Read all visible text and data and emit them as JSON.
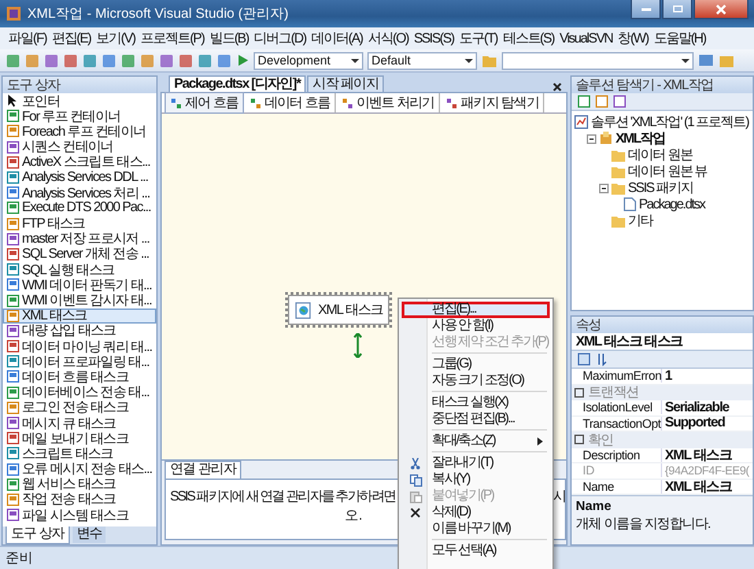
{
  "window": {
    "title": "XML작업 - Microsoft Visual Studio (관리자)"
  },
  "menu": [
    "파일(F)",
    "편집(E)",
    "보기(V)",
    "프로젝트(P)",
    "빌드(B)",
    "디버그(D)",
    "데이터(A)",
    "서식(O)",
    "SSIS(S)",
    "도구(T)",
    "테스트(S)",
    "VisualSVN",
    "창(W)",
    "도움말(H)"
  ],
  "toolbar": {
    "configuration": "Development",
    "platform": "Default"
  },
  "toolbox": {
    "title": "도구 상자",
    "items": [
      {
        "label": "포인터",
        "kind": "pointer",
        "selected": false
      },
      {
        "label": "For 루프 컨테이너",
        "kind": "task",
        "selected": false
      },
      {
        "label": "Foreach 루프 컨테이너",
        "kind": "task",
        "selected": false
      },
      {
        "label": "시퀀스 컨테이너",
        "kind": "task",
        "selected": false
      },
      {
        "label": "ActiveX 스크립트 태스...",
        "kind": "task",
        "selected": false
      },
      {
        "label": "Analysis Services DDL ...",
        "kind": "task",
        "selected": false
      },
      {
        "label": "Analysis Services 처리 ...",
        "kind": "task",
        "selected": false
      },
      {
        "label": "Execute DTS 2000 Pac...",
        "kind": "task",
        "selected": false
      },
      {
        "label": "FTP 태스크",
        "kind": "task",
        "selected": false
      },
      {
        "label": "master 저장 프로시저 ...",
        "kind": "task",
        "selected": false
      },
      {
        "label": "SQL Server 개체 전송 ...",
        "kind": "task",
        "selected": false
      },
      {
        "label": "SQL 실행 태스크",
        "kind": "task",
        "selected": false
      },
      {
        "label": "WMI 데이터 판독기 태...",
        "kind": "task",
        "selected": false
      },
      {
        "label": "WMI 이벤트 감시자 태...",
        "kind": "task",
        "selected": false
      },
      {
        "label": "XML 태스크",
        "kind": "task",
        "selected": true
      },
      {
        "label": "대량 삽입 태스크",
        "kind": "task",
        "selected": false
      },
      {
        "label": "데이터 마이닝 쿼리 태...",
        "kind": "task",
        "selected": false
      },
      {
        "label": "데이터 프로파일링 태...",
        "kind": "task",
        "selected": false
      },
      {
        "label": "데이터 흐름 태스크",
        "kind": "task",
        "selected": false
      },
      {
        "label": "데이터베이스 전송 태...",
        "kind": "task",
        "selected": false
      },
      {
        "label": "로그인 전송 태스크",
        "kind": "task",
        "selected": false
      },
      {
        "label": "메시지 큐 태스크",
        "kind": "task",
        "selected": false
      },
      {
        "label": "메일 보내기 태스크",
        "kind": "task",
        "selected": false
      },
      {
        "label": "스크립트 태스크",
        "kind": "task",
        "selected": false
      },
      {
        "label": "오류 메시지 전송 태스...",
        "kind": "task",
        "selected": false
      },
      {
        "label": "웹 서비스 태스크",
        "kind": "task",
        "selected": false
      },
      {
        "label": "작업 전송 태스크",
        "kind": "task",
        "selected": false
      },
      {
        "label": "파일 시스템 태스크",
        "kind": "task",
        "selected": false
      }
    ],
    "tabs": [
      {
        "label": "도구 상자",
        "selected": true
      },
      {
        "label": "변수",
        "selected": false
      }
    ]
  },
  "document_tabs": [
    {
      "label": "Package.dtsx [디자인]*",
      "selected": true
    },
    {
      "label": "시작 페이지",
      "selected": false
    }
  ],
  "designer_tabs": [
    {
      "label": "제어 흐름",
      "selected": true
    },
    {
      "label": "데이터 흐름",
      "selected": false
    },
    {
      "label": "이벤트 처리기",
      "selected": false
    },
    {
      "label": "패키지 탐색기",
      "selected": false
    }
  ],
  "task": {
    "label": "XML 태스크",
    "selected": true
  },
  "connections": {
    "title": "연결 관리자",
    "hint_start": "SSIS 패키지에 새 연결 관리자를 추가하려면",
    "hint_end": "시",
    "hint_line2": "오."
  },
  "context_menu": [
    {
      "kind": "plain",
      "label": "편집(E)...",
      "disabled": false,
      "highlighted": true
    },
    {
      "kind": "plain",
      "label": "사용 안 함(I)",
      "disabled": false,
      "highlighted": false
    },
    {
      "kind": "plain",
      "label": "선행 제약 조건 추가(P)",
      "disabled": true,
      "highlighted": false
    },
    {
      "kind": "separator"
    },
    {
      "kind": "plain",
      "label": "그룹(G)",
      "disabled": false,
      "highlighted": false
    },
    {
      "kind": "plain",
      "label": "자동 크기 조정(O)",
      "disabled": false,
      "highlighted": false
    },
    {
      "kind": "separator"
    },
    {
      "kind": "plain",
      "label": "태스크 실행(X)",
      "disabled": false,
      "highlighted": false
    },
    {
      "kind": "plain",
      "label": "중단점 편집(B)...",
      "disabled": false,
      "highlighted": false
    },
    {
      "kind": "separator"
    },
    {
      "kind": "submenu",
      "label": "확대/축소(Z)",
      "disabled": false,
      "highlighted": false
    },
    {
      "kind": "separator"
    },
    {
      "kind": "cut",
      "label": "잘라내기(T)",
      "disabled": false,
      "highlighted": false
    },
    {
      "kind": "copy",
      "label": "복사(Y)",
      "disabled": false,
      "highlighted": false
    },
    {
      "kind": "paste",
      "label": "붙여넣기(P)",
      "disabled": true,
      "highlighted": false
    },
    {
      "kind": "delete",
      "label": "삭제(D)",
      "disabled": false,
      "highlighted": false
    },
    {
      "kind": "plain",
      "label": "이름 바꾸기(M)",
      "disabled": false,
      "highlighted": false
    },
    {
      "kind": "separator"
    },
    {
      "kind": "plain",
      "label": "모두 선택(A)",
      "disabled": false,
      "highlighted": false
    }
  ],
  "solution_explorer": {
    "title": "솔루션 탐색기 - XML작업",
    "tree": [
      {
        "kind": "solution",
        "label": "솔루션 'XML작업' (1 프로젝트)",
        "children": [
          {
            "kind": "project",
            "label": "XML작업",
            "expanded": true,
            "children": [
              {
                "kind": "folder",
                "label": "데이터 원본"
              },
              {
                "kind": "folder",
                "label": "데이터 원본 뷰"
              },
              {
                "kind": "folder",
                "label": "SSIS 패키지",
                "expanded": true,
                "children": [
                  {
                    "kind": "file",
                    "label": "Package.dtsx"
                  }
                ]
              },
              {
                "kind": "folder",
                "label": "기타"
              }
            ]
          }
        ]
      }
    ]
  },
  "properties": {
    "title": "속성",
    "object": "XML 태스크 태스크",
    "rows": [
      {
        "kind": "property",
        "name": "MaximumErron",
        "value": "1",
        "disabled": false
      },
      {
        "kind": "category",
        "name": "트랜잭션"
      },
      {
        "kind": "property",
        "name": "IsolationLevel",
        "value": "Serializable",
        "disabled": false
      },
      {
        "kind": "property",
        "name": "TransactionOpt",
        "value": "Supported",
        "disabled": false
      },
      {
        "kind": "category",
        "name": "확인"
      },
      {
        "kind": "property",
        "name": "Description",
        "value": "XML 태스크",
        "disabled": false
      },
      {
        "kind": "property",
        "name": "ID",
        "value": "{94A2DF4F-EE9(",
        "disabled": true
      },
      {
        "kind": "property",
        "name": "Name",
        "value": "XML 태스크",
        "disabled": false
      }
    ],
    "description_title": "Name",
    "description": "개체 이름을 지정합니다."
  },
  "status_bar": "준비"
}
